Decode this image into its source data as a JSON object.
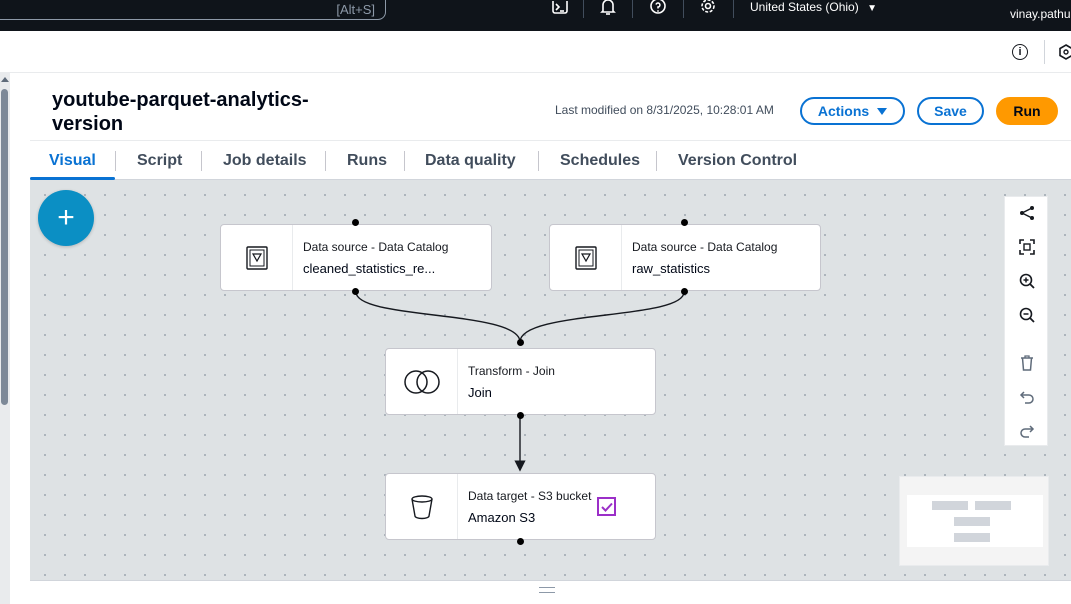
{
  "topbar": {
    "search_shortcut": "[Alt+S]",
    "region": "United States (Ohio)",
    "user": "vinay.pathu",
    "icons": [
      "cloudshell-icon",
      "bell-icon",
      "help-icon",
      "gear-icon"
    ]
  },
  "header": {
    "title": "youtube-parquet-analytics-version",
    "modified": "Last modified on 8/31/2025, 10:28:01 AM",
    "actions_label": "Actions",
    "save_label": "Save",
    "run_label": "Run"
  },
  "tabs": [
    "Visual",
    "Script",
    "Job details",
    "Runs",
    "Data quality",
    "Schedules",
    "Version Control"
  ],
  "active_tab": "Visual",
  "add_button": "+",
  "nodes": {
    "source1": {
      "kind": "Data source - Data Catalog",
      "name": "cleaned_statistics_re..."
    },
    "source2": {
      "kind": "Data source - Data Catalog",
      "name": "raw_statistics"
    },
    "join": {
      "kind": "Transform - Join",
      "name": "Join"
    },
    "target": {
      "kind": "Data target - S3 bucket",
      "name": "Amazon S3"
    }
  },
  "toolbar": [
    "share-layout-icon",
    "fit-screen-icon",
    "zoom-in-icon",
    "zoom-out-icon",
    "delete-icon",
    "undo-icon",
    "redo-icon"
  ],
  "colors": {
    "accent": "#0972d3",
    "run": "#ff9900",
    "add": "#0b8fc4",
    "check": "#9b2fc8"
  }
}
